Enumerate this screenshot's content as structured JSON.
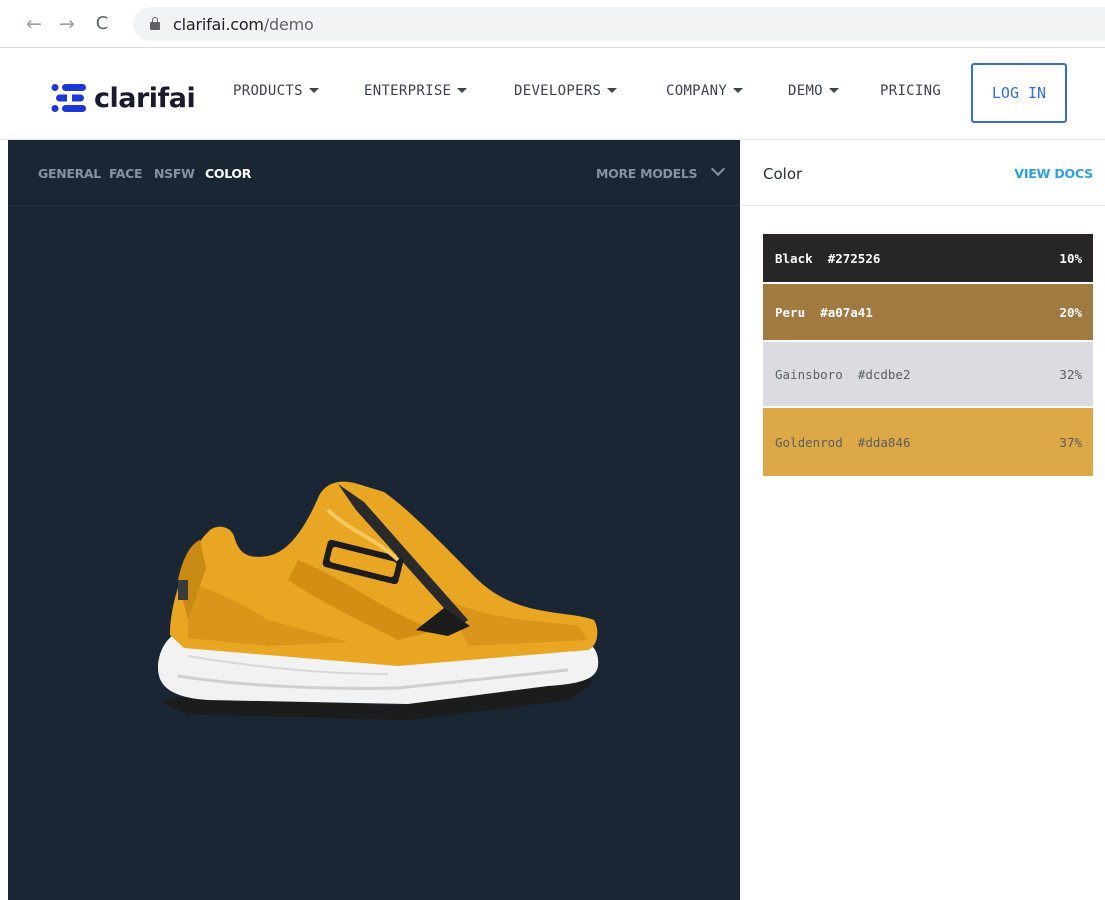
{
  "browser": {
    "back_glyph": "←",
    "forward_glyph": "→",
    "reload_glyph": "C",
    "url_domain": "clarifai.com",
    "url_path": "/demo"
  },
  "header": {
    "logo_text": "clarifai",
    "nav": [
      {
        "label": "PRODUCTS"
      },
      {
        "label": "ENTERPRISE"
      },
      {
        "label": "DEVELOPERS"
      },
      {
        "label": "COMPANY"
      },
      {
        "label": "DEMO"
      },
      {
        "label": "PRICING"
      }
    ],
    "login_label": "LOG IN"
  },
  "demo": {
    "model_tabs": [
      {
        "label": "GENERAL",
        "active": false
      },
      {
        "label": "FACE",
        "active": false
      },
      {
        "label": "NSFW",
        "active": false
      },
      {
        "label": "COLOR",
        "active": true
      }
    ],
    "more_models_label": "MORE MODELS"
  },
  "panel": {
    "title": "Color",
    "view_docs_label": "VIEW DOCS",
    "colors": [
      {
        "name": "Black",
        "hex": "#272526",
        "percent": "10%"
      },
      {
        "name": "Peru",
        "hex": "#a07a41",
        "percent": "20%"
      },
      {
        "name": "Gainsboro",
        "hex": "#dcdbe2",
        "percent": "32%"
      },
      {
        "name": "Goldenrod",
        "hex": "#dda846",
        "percent": "37%"
      }
    ]
  },
  "colors": {
    "panel_bg": "#1b2634",
    "accent_blue": "#356dde",
    "docs_blue": "#2e9fe6",
    "shoe_yellow": "#e8a623"
  }
}
